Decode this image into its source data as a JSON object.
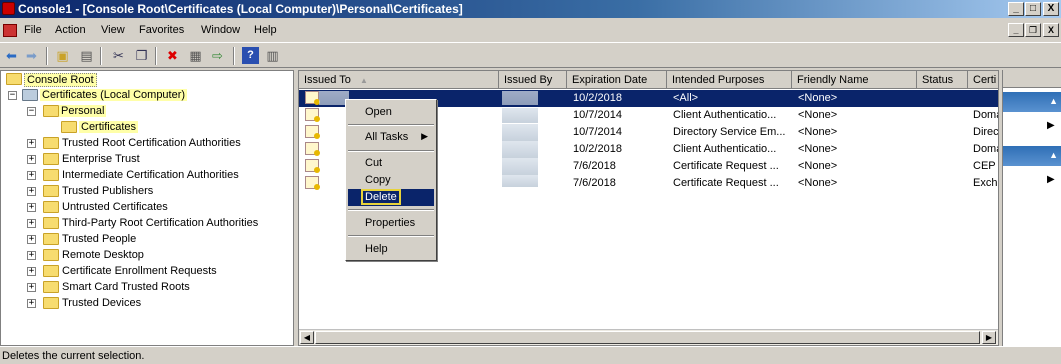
{
  "window": {
    "title": "Console1 - [Console Root\\Certificates (Local Computer)\\Personal\\Certificates]",
    "minimize": "_",
    "maximize": "□",
    "close": "X"
  },
  "menu": {
    "items": [
      "File",
      "Action",
      "View",
      "Favorites",
      "Window",
      "Help"
    ],
    "mdi_minimize": "_",
    "mdi_restore": "❐",
    "mdi_close": "X"
  },
  "toolbar": {
    "buttons": [
      "back-icon",
      "forward-icon",
      "up-folder-icon",
      "show-hide-tree-icon",
      "cut-icon",
      "copy-icon",
      "delete-icon",
      "properties-icon",
      "export-list-icon",
      "help-icon",
      "action-pane-icon"
    ]
  },
  "tree": {
    "nodes": [
      {
        "label": "Console Root",
        "selected_style": "highlight"
      },
      {
        "label": "Certificates (Local Computer)",
        "expander": "−"
      },
      {
        "label": "Personal",
        "expander": "−"
      },
      {
        "label": "Certificates",
        "selected": true
      },
      {
        "label": "Trusted Root Certification Authorities",
        "expander": "+"
      },
      {
        "label": "Enterprise Trust",
        "expander": "+"
      },
      {
        "label": "Intermediate Certification Authorities",
        "expander": "+"
      },
      {
        "label": "Trusted Publishers",
        "expander": "+"
      },
      {
        "label": "Untrusted Certificates",
        "expander": "+"
      },
      {
        "label": "Third-Party Root Certification Authorities",
        "expander": "+"
      },
      {
        "label": "Trusted People",
        "expander": "+"
      },
      {
        "label": "Remote Desktop",
        "expander": "+"
      },
      {
        "label": "Certificate Enrollment Requests",
        "expander": "+"
      },
      {
        "label": "Smart Card Trusted Roots",
        "expander": "+"
      },
      {
        "label": "Trusted Devices",
        "expander": "+"
      }
    ]
  },
  "list": {
    "columns": [
      "Issued To",
      "Issued By",
      "Expiration Date",
      "Intended Purposes",
      "Friendly Name",
      "Status",
      "Certi"
    ],
    "sort_indicator": "▲",
    "rows": [
      {
        "expiration": "10/2/2018",
        "purposes": "<All>",
        "friendly": "<None>",
        "status": "",
        "template": "",
        "selected": true
      },
      {
        "expiration": "10/7/2014",
        "purposes": "Client Authenticatio...",
        "friendly": "<None>",
        "status": "",
        "template": "Doma"
      },
      {
        "expiration": "10/7/2014",
        "purposes": "Directory Service Em...",
        "friendly": "<None>",
        "status": "",
        "template": "Direc"
      },
      {
        "expiration": "10/2/2018",
        "purposes": "Client Authenticatio...",
        "friendly": "<None>",
        "status": "",
        "template": "Doma"
      },
      {
        "expiration": "7/6/2018",
        "purposes": "Certificate Request ...",
        "friendly": "<None>",
        "status": "",
        "template": "CEP E"
      },
      {
        "expiration": "7/6/2018",
        "purposes": "Certificate Request ...",
        "friendly": "<None>",
        "status": "",
        "template": "Exch"
      }
    ]
  },
  "context_menu": {
    "items": [
      "Open",
      "All Tasks",
      "Cut",
      "Copy",
      "Delete",
      "Properties",
      "Help"
    ],
    "submenu_arrow": "▶",
    "highlighted": "Delete"
  },
  "actions_pane": {
    "collapse_chevron": "▲",
    "more_arrow": "▶"
  },
  "status_bar": {
    "text": "Deletes the current selection."
  }
}
